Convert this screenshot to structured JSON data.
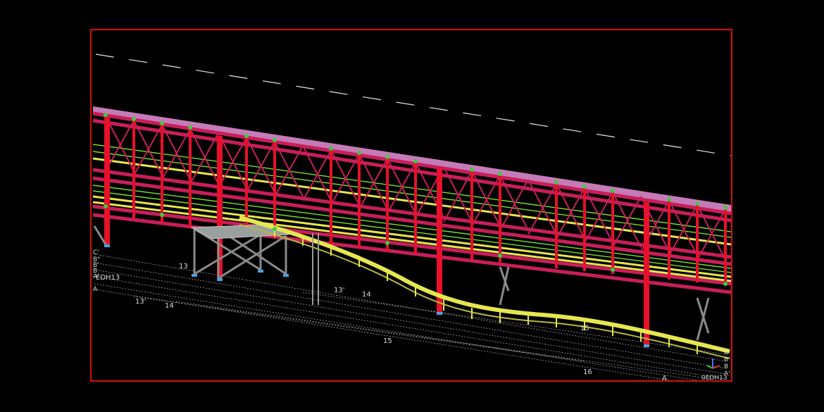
{
  "viewport": {
    "frame_color": "#d01010",
    "background": "#000000"
  },
  "colors": {
    "truss_red": "#e8102a",
    "truss_magenta": "#c81e5a",
    "walkway_yellow": "#e6e650",
    "railing_green": "#74e02a",
    "bolt_green": "#3ccc3c",
    "roof_pink": "#e890d8",
    "bracing_grey": "#8a8a8a",
    "gridline_white": "#cfcfcf",
    "dash_white": "#e6e6e6"
  },
  "grid_labels": {
    "left_stack": [
      "C'",
      "B\"",
      "B'",
      "B",
      "A'",
      "A"
    ],
    "left_tag": "EDH13",
    "g13_a": "13",
    "g13p_a": "13'",
    "g14_a": "14",
    "g13p_b": "13'",
    "g14_b": "14",
    "g15": "15",
    "g15_b": "15",
    "g16": "16",
    "right_bottom_a": "A",
    "right_tag": "0EDH13",
    "right_stack": [
      "C",
      "B'",
      "B",
      "A'"
    ]
  },
  "icons": {
    "ucs": "ucs-axis-icon"
  }
}
